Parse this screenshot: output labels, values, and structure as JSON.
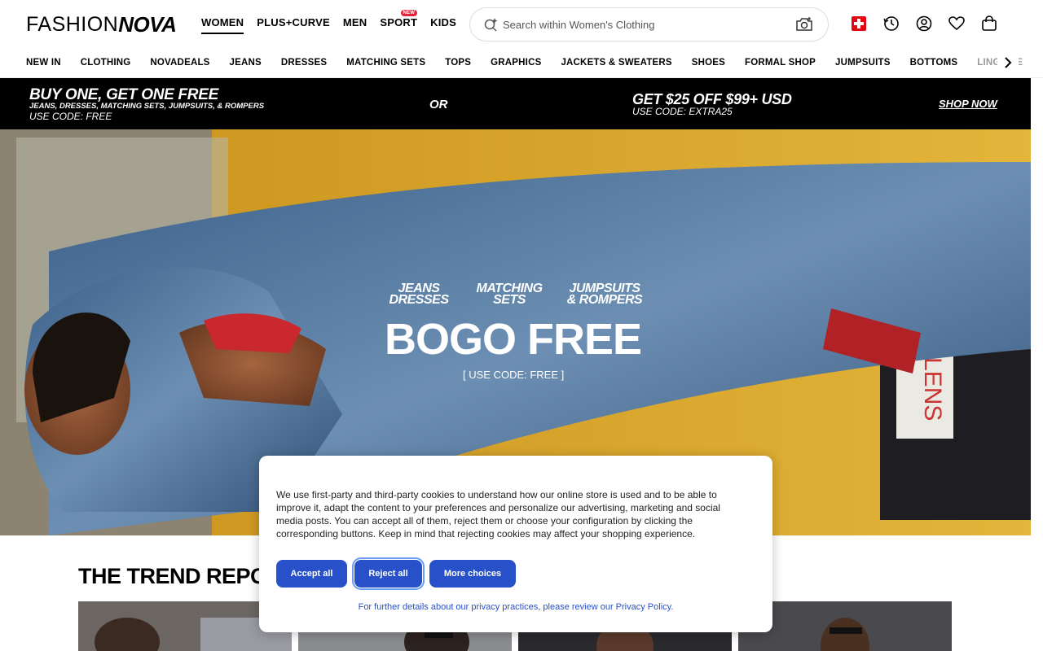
{
  "header": {
    "logo_part1": "FASHION",
    "logo_part2": "NOVA",
    "gender_tabs": [
      {
        "label": "WOMEN",
        "active": true
      },
      {
        "label": "PLUS+CURVE"
      },
      {
        "label": "MEN"
      },
      {
        "label": "SPORT",
        "badge": "NEW"
      },
      {
        "label": "KIDS"
      }
    ],
    "search": {
      "placeholder": "Search within Women's Clothing",
      "icon": "search-sparkle-icon",
      "camera_icon": "camera-search-icon"
    },
    "icons": [
      "swiss-flag-icon",
      "history-icon",
      "account-icon",
      "heart-icon",
      "bag-icon"
    ]
  },
  "category_nav": {
    "items": [
      "NEW IN",
      "CLOTHING",
      "NOVADEALS",
      "JEANS",
      "DRESSES",
      "MATCHING SETS",
      "TOPS",
      "GRAPHICS",
      "JACKETS & SWEATERS",
      "SHOES",
      "FORMAL SHOP",
      "JUMPSUITS",
      "BOTTOMS",
      "LINGERIE"
    ],
    "arrow_icon": "chevron-right-icon"
  },
  "promo": {
    "left_title": "BUY ONE, GET ONE FREE",
    "left_sub": "JEANS, DRESSES, MATCHING SETS, JUMPSUITS, & ROMPERS",
    "left_code": "USE CODE: FREE",
    "or": "OR",
    "right_title": "GET $25 OFF $99+ USD",
    "right_code": "USE CODE: EXTRA25",
    "cta": "SHOP NOW",
    "bg_color": "#000000"
  },
  "hero": {
    "cat1_line1": "JEANS",
    "cat1_line2": "DRESSES",
    "cat2_line1": "MATCHING",
    "cat2_line2": "SETS",
    "cat3_line1": "JUMPSUITS",
    "cat3_line2": "& ROMPERS",
    "headline": "BOGO FREE",
    "code": "[ USE CODE: FREE ]"
  },
  "trend": {
    "title": "THE TREND REPORT"
  },
  "cookie": {
    "text": "We use first-party and third-party cookies to understand how our online store is used and to be able to improve it, adapt the content to your preferences and personalize our advertising, marketing and social media posts. You can accept all of them, reject them or choose your configuration by clicking the corresponding buttons. Keep in mind that rejecting cookies may affect your shopping experience.",
    "accept": "Accept all",
    "reject": "Reject all",
    "more": "More choices",
    "footer": "For further details about our privacy practices, please review our Privacy Policy.",
    "button_color": "#2750c9"
  }
}
